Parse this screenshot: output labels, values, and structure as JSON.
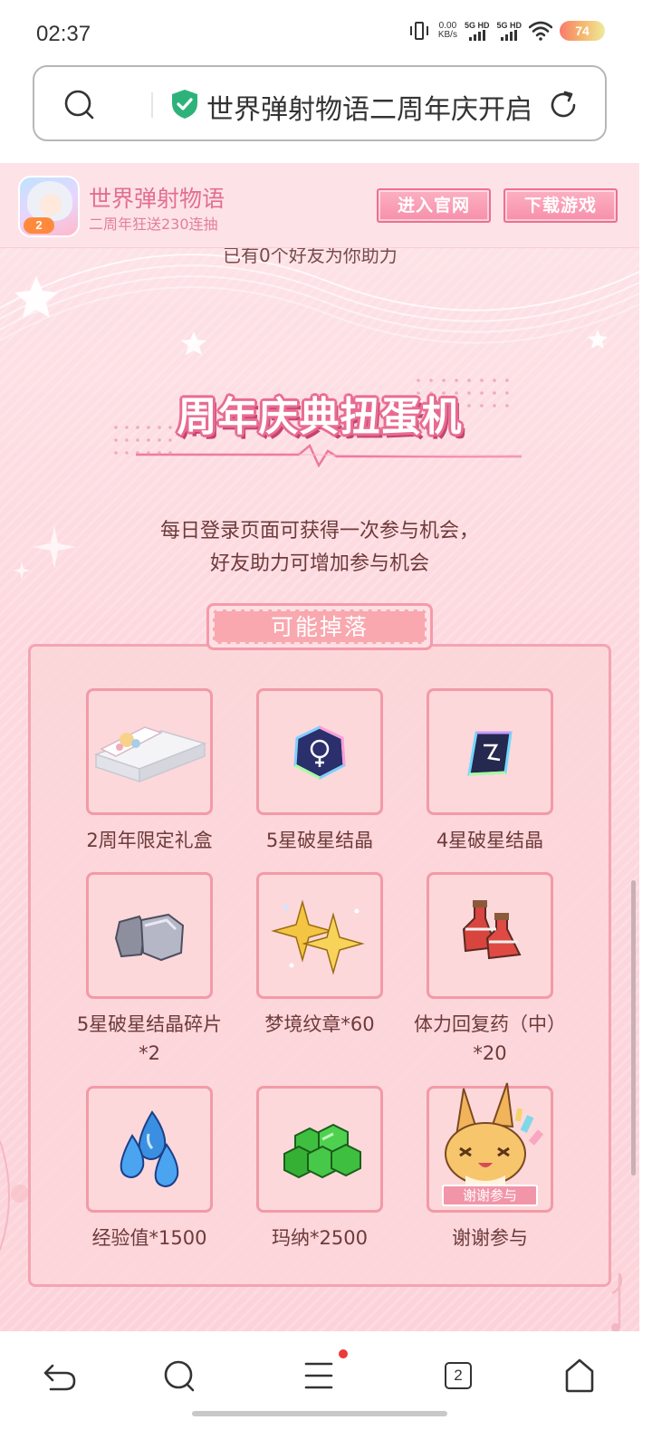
{
  "status_bar": {
    "time": "02:37",
    "net_speed_value": "0.00",
    "net_speed_unit": "KB/s",
    "sim1": "5G HD",
    "sim2": "5G HD",
    "battery": "74"
  },
  "address_bar": {
    "title": "世界弹射物语二周年庆开启",
    "icons": [
      "search-icon",
      "shield-check-icon",
      "reload-icon"
    ]
  },
  "banner": {
    "app_name": "世界弹射物语",
    "app_subtitle": "二周年狂送230连抽",
    "official_site_label": "进入官网",
    "download_label": "下载游戏"
  },
  "page": {
    "peek_text": "已有0个好友为你助力",
    "section_title": "周年庆典扭蛋机",
    "description_line1": "每日登录页面可获得一次参与机会，",
    "description_line2": "好友助力可增加参与机会",
    "drop_label": "可能掉落",
    "prizes": [
      {
        "name": "2周年限定礼盒",
        "icon": "gift-box-icon"
      },
      {
        "name": "5星破星结晶",
        "icon": "star-crystal-5-icon"
      },
      {
        "name": "4星破星结晶",
        "icon": "star-crystal-4-icon"
      },
      {
        "name": "5星破星结晶碎片*2",
        "icon": "crystal-fragment-icon"
      },
      {
        "name": "梦境纹章*60",
        "icon": "dream-emblem-icon"
      },
      {
        "name": "体力回复药（中）*20",
        "icon": "stamina-potion-icon"
      },
      {
        "name": "经验值*1500",
        "icon": "exp-drop-icon"
      },
      {
        "name": "玛纳*2500",
        "icon": "mana-gem-icon"
      },
      {
        "name": "谢谢参与",
        "icon": "thanks-fox-icon",
        "tag": "谢谢参与"
      }
    ],
    "colors": {
      "accent_pink": "#e96b92",
      "box_border": "#f4a4b2",
      "text_brown": "#6e3a3a"
    }
  },
  "bottom_nav": {
    "tab_count": "2",
    "icons": [
      "back-icon",
      "search-icon",
      "menu-icon",
      "tabs-icon",
      "home-icon"
    ]
  }
}
